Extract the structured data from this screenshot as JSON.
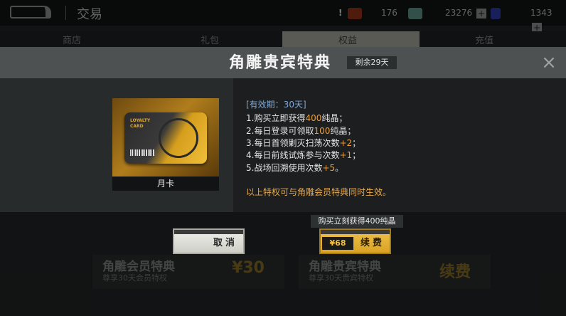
{
  "topbar": {
    "page_title": "交易",
    "alert": "!",
    "stamina": "176",
    "crystals": "23276",
    "plus": "+",
    "shards": "1343"
  },
  "background": {
    "tabs": [
      "商店",
      "礼包",
      "权益",
      "充值"
    ],
    "cards": [
      {
        "title": "角雕会员特典",
        "subtitle": "尊享30天会员特权",
        "price": "¥30"
      },
      {
        "title": "角雕贵宾特典",
        "subtitle": "尊享30天贵宾特权",
        "price": "续费"
      }
    ]
  },
  "modal": {
    "title": "角雕贵宾特典",
    "days_left": "剩余29天",
    "close": "×",
    "card": {
      "label": "月卡",
      "card_text_1": "LOYALTY",
      "card_text_2": "CARD"
    },
    "validity": "[有效期：30天]",
    "benefits": [
      {
        "pre": "1.购买立即获得",
        "hl": "400",
        "post": "纯晶；"
      },
      {
        "pre": "2.每日登录可领取",
        "hl": "100",
        "post": "纯晶；"
      },
      {
        "pre": "3.每日首领剿灭扫荡次数",
        "hl": "+2",
        "post": "；"
      },
      {
        "pre": "4.每日前线试炼参与次数",
        "hl": "+1",
        "post": "；"
      },
      {
        "pre": "5.战场回溯使用次数",
        "hl": "+5",
        "post": "。"
      }
    ],
    "footnote": "以上特权可与角雕会员特典同时生效。",
    "tip": "购买立刻获得400纯晶",
    "cancel_label": "取消",
    "renew_price": "¥68",
    "renew_label": "续费"
  }
}
